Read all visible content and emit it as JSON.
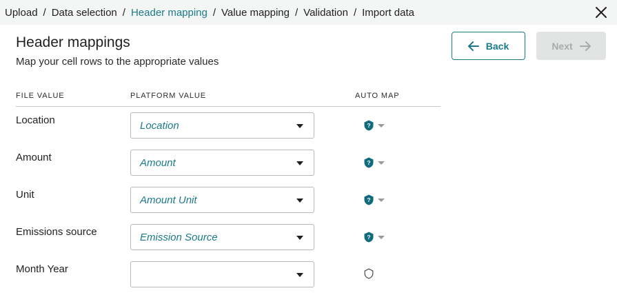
{
  "breadcrumb": [
    {
      "label": "Upload",
      "active": false
    },
    {
      "label": "Data selection",
      "active": false
    },
    {
      "label": "Header mapping",
      "active": true
    },
    {
      "label": "Value mapping",
      "active": false
    },
    {
      "label": "Validation",
      "active": false
    },
    {
      "label": "Import data",
      "active": false
    }
  ],
  "breadcrumb_separator": "/",
  "header": {
    "title": "Header mappings",
    "subtitle": "Map your cell rows to the appropriate values"
  },
  "buttons": {
    "back_label": "Back",
    "next_label": "Next"
  },
  "columns": {
    "file_value": "FILE VALUE",
    "platform_value": "PLATFORM VALUE",
    "auto_map": "AUTO MAP"
  },
  "rows": [
    {
      "file_value": "Location",
      "platform_value": "Location",
      "auto_mapped": true
    },
    {
      "file_value": "Amount",
      "platform_value": "Amount",
      "auto_mapped": true
    },
    {
      "file_value": "Unit",
      "platform_value": "Amount Unit",
      "auto_mapped": true
    },
    {
      "file_value": "Emissions source",
      "platform_value": "Emission Source",
      "auto_mapped": true
    },
    {
      "file_value": "Month Year",
      "platform_value": "",
      "auto_mapped": false
    }
  ],
  "icons": {
    "close": "close-icon",
    "back": "arrow-left-icon",
    "next": "arrow-right-icon",
    "dropdown": "chevron-down-icon",
    "auto_mapped": "shield-question-icon",
    "not_mapped": "shield-outline-icon"
  },
  "colors": {
    "accent": "#1a7a8a",
    "shield": "#0f6b7d",
    "disabled_bg": "#e2e3e3",
    "disabled_text": "#a9abab",
    "topbar_bg": "#f4f5f5"
  }
}
